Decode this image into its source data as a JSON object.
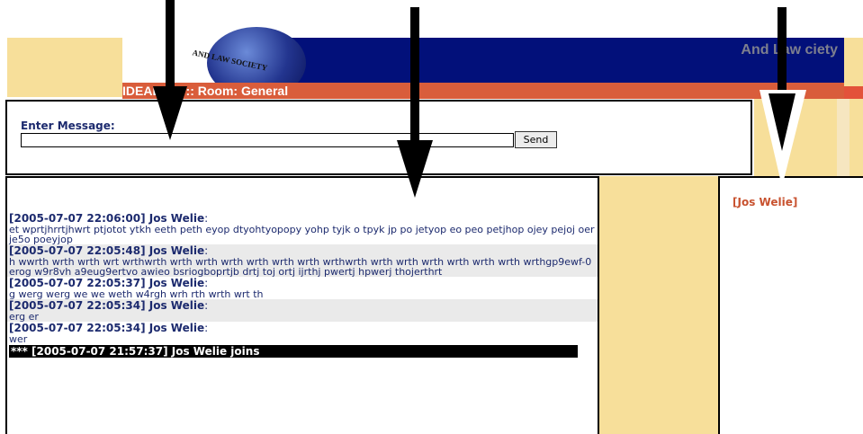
{
  "header": {
    "logo_text": "AND LAW SOCIETY",
    "tagline": "And Law   ciety",
    "title": "IDEAL   hat :: Room: General"
  },
  "compose": {
    "label": "Enter Message:",
    "input_value": "",
    "send_label": "Send"
  },
  "users": [
    "[Jos Welie]"
  ],
  "messages": [
    {
      "head": "[2005-07-07 22:06:00] Jos Welie",
      "body": "et wprtjhrrtjhwrt ptjotot ytkh eeth peth eyop dtyohtyopopy yohp tyjk o tpyk jp po jetyop eo peo petjhop ojey pejoj oerje5o poeyjop",
      "shaded": false
    },
    {
      "head": "[2005-07-07 22:05:48] Jos Welie",
      "body": "h wwrth wrth wrth wrt wrthwrth wrth wrth wrth wrth wrth wrth wrthwrth wrth wrth wrth wrth wrth wrth wrthgp9ewf-0erog w9r8vh a9eug9ertvo awieo bsriogboprtjb drtj toj ortj ijrthj pwertj hpwerj thojerthrt",
      "shaded": true
    },
    {
      "head": "[2005-07-07 22:05:37] Jos Welie",
      "body": "g werg werg we we weth w4rgh wrh rth wrth wrt th",
      "shaded": false
    },
    {
      "head": "[2005-07-07 22:05:34] Jos Welie",
      "body": "erg er",
      "shaded": true
    },
    {
      "head": "[2005-07-07 22:05:34] Jos Welie",
      "body": "wer",
      "shaded": false
    }
  ],
  "join_notice": "*** [2005-07-07 21:57:37] Jos Welie joins",
  "colors": {
    "banner_blue": "#02107a",
    "title_bar": "#d95d3b",
    "tan": "#f7df9a",
    "text_navy": "#1c2a6e",
    "user_red": "#c8522f"
  },
  "icons": [
    "globe-logo-icon",
    "down-arrow-icon"
  ]
}
